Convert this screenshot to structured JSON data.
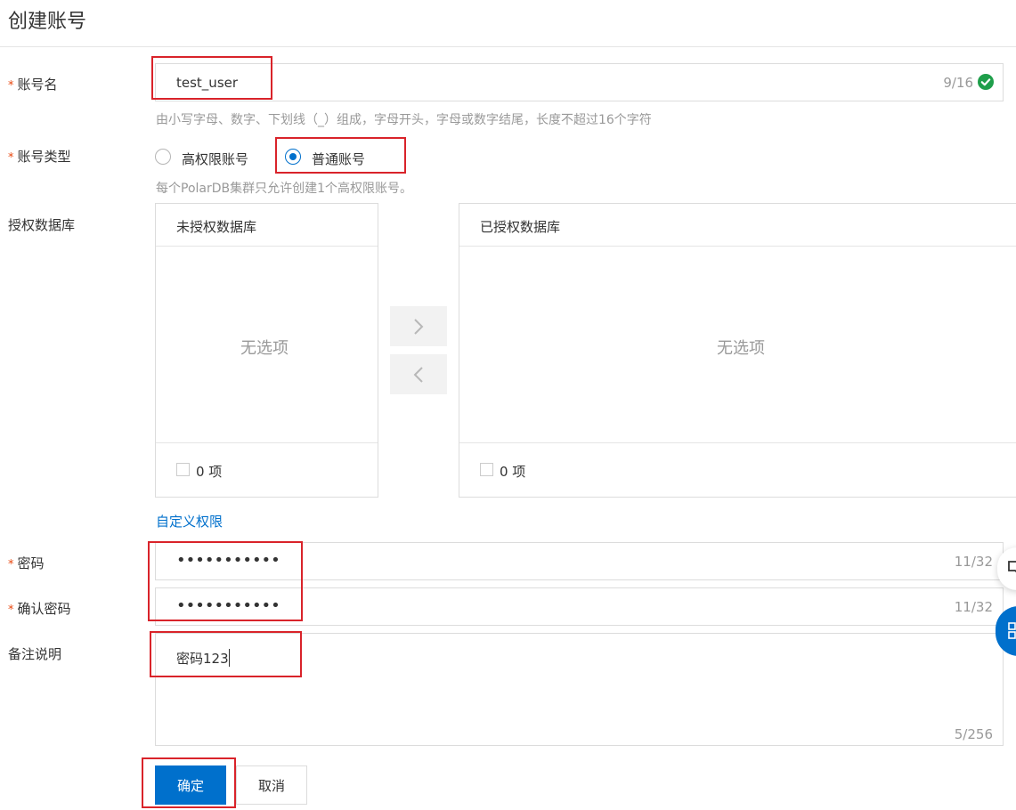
{
  "page": {
    "title": "创建账号"
  },
  "form": {
    "account_name": {
      "label": "账号名",
      "required_mark": "*",
      "value": "test_user",
      "counter": "9/16",
      "hint": "由小写字母、数字、下划线（_）组成，字母开头，字母或数字结尾，长度不超过16个字符"
    },
    "account_type": {
      "label": "账号类型",
      "required_mark": "*",
      "options": [
        {
          "label": "高权限账号",
          "selected": false
        },
        {
          "label": "普通账号",
          "selected": true
        }
      ],
      "hint": "每个PolarDB集群只允许创建1个高权限账号。"
    },
    "databases": {
      "label": "授权数据库",
      "left": {
        "title": "未授权数据库",
        "empty": "无选项",
        "count": "0 项"
      },
      "right": {
        "title": "已授权数据库",
        "empty": "无选项",
        "count": "0 项"
      },
      "custom_link": "自定义权限"
    },
    "password": {
      "label": "密码",
      "required_mark": "*",
      "value": "•••••••••••",
      "counter": "11/32"
    },
    "confirm_password": {
      "label": "确认密码",
      "required_mark": "*",
      "value": "•••••••••••",
      "counter": "11/32"
    },
    "remark": {
      "label": "备注说明",
      "value": "密码123",
      "counter": "5/256"
    }
  },
  "actions": {
    "confirm": "确定",
    "cancel": "取消"
  },
  "colors": {
    "primary": "#0070cc",
    "required": "#e8470f",
    "highlight": "#d9232a",
    "success": "#1e9e4a"
  }
}
